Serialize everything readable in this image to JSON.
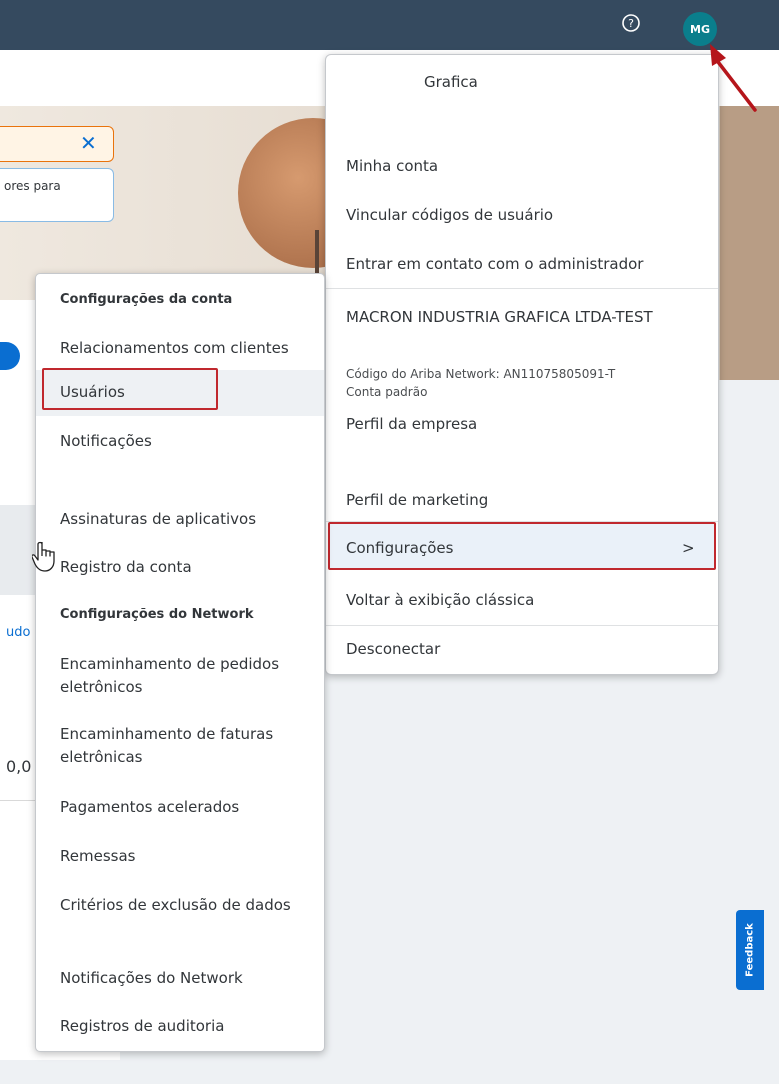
{
  "topbar": {
    "avatar_initials": "MG",
    "help_icon": "question-circle-icon"
  },
  "background": {
    "toast_close_icon": "close-icon",
    "info_card_text": "ores para",
    "left_link_text": "udo",
    "left_value_text": "0,0"
  },
  "user_menu": {
    "user_name": "Grafica",
    "items": {
      "my_account": "Minha conta",
      "link_user_ids": "Vincular códigos de usuário",
      "contact_admin": "Entrar em contato com o administrador",
      "company_name": "MACRON INDUSTRIA GRAFICA LTDA-TEST",
      "ariba_id": "Código do Ariba Network: AN11075805091-T",
      "default_account": "Conta padrão",
      "company_profile": "Perfil da empresa",
      "marketing_profile": "Perfil de marketing",
      "settings": "Configurações",
      "settings_chevron": ">",
      "classic_view": "Voltar à exibição clássica",
      "logout": "Desconectar"
    }
  },
  "settings_menu": {
    "account_header": "Configurações da conta",
    "account_items": [
      "Relacionamentos com clientes",
      "Usuários",
      "Notificações",
      "Assinaturas de aplicativos",
      "Registro da conta"
    ],
    "network_header": "Configurações do Network",
    "network_items": [
      "Encaminhamento de pedidos eletrônicos",
      "Encaminhamento de faturas eletrônicas",
      "Pagamentos acelerados",
      "Remessas",
      "Critérios de exclusão de dados",
      "Notificações do Network",
      "Registros de auditoria"
    ]
  },
  "feedback": {
    "label": "Feedback"
  },
  "colors": {
    "header": "#354a5f",
    "avatar": "#0a7e8c",
    "accent": "#0a6ed1",
    "annotation": "#c0282e"
  }
}
